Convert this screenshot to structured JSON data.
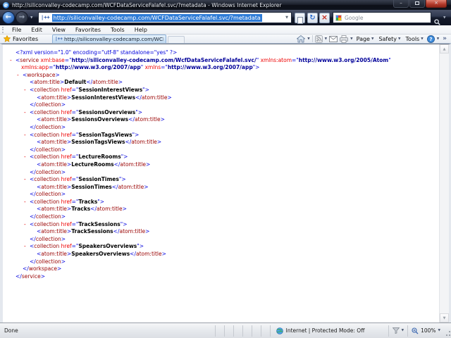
{
  "window": {
    "title": "http://siliconvalley-codecamp.com/WCFDataServiceFalafel.svc/?metadata - Windows Internet Explorer"
  },
  "icons": {
    "ie_logo": "e",
    "back": "←",
    "forward": "→",
    "dropdown": "▼",
    "refresh": "↻",
    "stop": "×",
    "minimize": "–",
    "close": "×",
    "scroll_up": "▲",
    "scroll_down": "▼",
    "overflow": "»",
    "help": "?"
  },
  "nav": {
    "address": "http://siliconvalley-codecamp.com/WCFDataServiceFalafel.svc/?metadata",
    "favicon_text": "|++",
    "search_placeholder": "Google"
  },
  "menu": {
    "items": [
      "File",
      "Edit",
      "View",
      "Favorites",
      "Tools",
      "Help"
    ]
  },
  "favorites": {
    "label": "Favorites",
    "tab": {
      "favicon_text": "|++",
      "title": "http://siliconvalley-codecamp.com/WCFDataSer..."
    },
    "commands": {
      "page": "Page",
      "safety": "Safety",
      "tools": "Tools"
    }
  },
  "status": {
    "text": "Done",
    "zone": "Internet | Protected Mode: Off",
    "zoom_level": "100%"
  },
  "colors": {
    "xml_markup": "#0000dd",
    "xml_tag": "#990000",
    "xml_attr": "#ee0000",
    "xml_url_value": "#000099",
    "xml_text": "#000000",
    "selection": "#2e7bd6",
    "close_button": "#b33a2b"
  },
  "xml": {
    "lines": [
      {
        "i": 0,
        "d": false,
        "segs": [
          [
            "m",
            "<?xml version=\"1.0\" encoding=\"utf-8\" standalone=\"yes\" ?>"
          ]
        ]
      },
      {
        "i": 0,
        "d": true,
        "segs": [
          [
            "m",
            "<"
          ],
          [
            "t",
            "service"
          ],
          [
            "a",
            " xml:base"
          ],
          [
            "m",
            "=\""
          ],
          [
            "u",
            "http://siliconvalley-codecamp.com/WcfDataServiceFalafel.svc/"
          ],
          [
            "m",
            "\" "
          ],
          [
            "a",
            "xmlns:atom"
          ],
          [
            "m",
            "=\""
          ],
          [
            "u",
            "http://www.w3.org/2005/Atom"
          ],
          [
            "m",
            "\""
          ]
        ]
      },
      {
        "i": 0,
        "d": false,
        "c": true,
        "segs": [
          [
            "a",
            "xmlns:app"
          ],
          [
            "m",
            "=\""
          ],
          [
            "u",
            "http://www.w3.org/2007/app"
          ],
          [
            "m",
            "\" "
          ],
          [
            "a",
            "xmlns"
          ],
          [
            "m",
            "=\""
          ],
          [
            "u",
            "http://www.w3.org/2007/app"
          ],
          [
            "m",
            "\">"
          ]
        ]
      },
      {
        "i": 1,
        "d": true,
        "segs": [
          [
            "m",
            "<"
          ],
          [
            "t",
            "workspace"
          ],
          [
            "m",
            ">"
          ]
        ]
      },
      {
        "i": 2,
        "d": false,
        "segs": [
          [
            "m",
            "<"
          ],
          [
            "t",
            "atom:title"
          ],
          [
            "m",
            ">"
          ],
          [
            "b",
            "Default"
          ],
          [
            "m",
            "</"
          ],
          [
            "t",
            "atom:title"
          ],
          [
            "m",
            ">"
          ]
        ]
      },
      {
        "i": 2,
        "d": true,
        "segs": [
          [
            "m",
            "<"
          ],
          [
            "t",
            "collection"
          ],
          [
            "a",
            " href"
          ],
          [
            "m",
            "=\""
          ],
          [
            "b",
            "SessionInterestViews"
          ],
          [
            "m",
            "\">"
          ]
        ]
      },
      {
        "i": 3,
        "d": false,
        "segs": [
          [
            "m",
            "<"
          ],
          [
            "t",
            "atom:title"
          ],
          [
            "m",
            ">"
          ],
          [
            "b",
            "SessionInterestViews"
          ],
          [
            "m",
            "</"
          ],
          [
            "t",
            "atom:title"
          ],
          [
            "m",
            ">"
          ]
        ]
      },
      {
        "i": 2,
        "d": false,
        "segs": [
          [
            "m",
            "</"
          ],
          [
            "t",
            "collection"
          ],
          [
            "m",
            ">"
          ]
        ]
      },
      {
        "i": 2,
        "d": true,
        "segs": [
          [
            "m",
            "<"
          ],
          [
            "t",
            "collection"
          ],
          [
            "a",
            " href"
          ],
          [
            "m",
            "=\""
          ],
          [
            "b",
            "SessionsOverviews"
          ],
          [
            "m",
            "\">"
          ]
        ]
      },
      {
        "i": 3,
        "d": false,
        "segs": [
          [
            "m",
            "<"
          ],
          [
            "t",
            "atom:title"
          ],
          [
            "m",
            ">"
          ],
          [
            "b",
            "SessionsOverviews"
          ],
          [
            "m",
            "</"
          ],
          [
            "t",
            "atom:title"
          ],
          [
            "m",
            ">"
          ]
        ]
      },
      {
        "i": 2,
        "d": false,
        "segs": [
          [
            "m",
            "</"
          ],
          [
            "t",
            "collection"
          ],
          [
            "m",
            ">"
          ]
        ]
      },
      {
        "i": 2,
        "d": true,
        "segs": [
          [
            "m",
            "<"
          ],
          [
            "t",
            "collection"
          ],
          [
            "a",
            " href"
          ],
          [
            "m",
            "=\""
          ],
          [
            "b",
            "SessionTagsViews"
          ],
          [
            "m",
            "\">"
          ]
        ]
      },
      {
        "i": 3,
        "d": false,
        "segs": [
          [
            "m",
            "<"
          ],
          [
            "t",
            "atom:title"
          ],
          [
            "m",
            ">"
          ],
          [
            "b",
            "SessionTagsViews"
          ],
          [
            "m",
            "</"
          ],
          [
            "t",
            "atom:title"
          ],
          [
            "m",
            ">"
          ]
        ]
      },
      {
        "i": 2,
        "d": false,
        "segs": [
          [
            "m",
            "</"
          ],
          [
            "t",
            "collection"
          ],
          [
            "m",
            ">"
          ]
        ]
      },
      {
        "i": 2,
        "d": true,
        "segs": [
          [
            "m",
            "<"
          ],
          [
            "t",
            "collection"
          ],
          [
            "a",
            " href"
          ],
          [
            "m",
            "=\""
          ],
          [
            "b",
            "LectureRooms"
          ],
          [
            "m",
            "\">"
          ]
        ]
      },
      {
        "i": 3,
        "d": false,
        "segs": [
          [
            "m",
            "<"
          ],
          [
            "t",
            "atom:title"
          ],
          [
            "m",
            ">"
          ],
          [
            "b",
            "LectureRooms"
          ],
          [
            "m",
            "</"
          ],
          [
            "t",
            "atom:title"
          ],
          [
            "m",
            ">"
          ]
        ]
      },
      {
        "i": 2,
        "d": false,
        "segs": [
          [
            "m",
            "</"
          ],
          [
            "t",
            "collection"
          ],
          [
            "m",
            ">"
          ]
        ]
      },
      {
        "i": 2,
        "d": true,
        "segs": [
          [
            "m",
            "<"
          ],
          [
            "t",
            "collection"
          ],
          [
            "a",
            " href"
          ],
          [
            "m",
            "=\""
          ],
          [
            "b",
            "SessionTimes"
          ],
          [
            "m",
            "\">"
          ]
        ]
      },
      {
        "i": 3,
        "d": false,
        "segs": [
          [
            "m",
            "<"
          ],
          [
            "t",
            "atom:title"
          ],
          [
            "m",
            ">"
          ],
          [
            "b",
            "SessionTimes"
          ],
          [
            "m",
            "</"
          ],
          [
            "t",
            "atom:title"
          ],
          [
            "m",
            ">"
          ]
        ]
      },
      {
        "i": 2,
        "d": false,
        "segs": [
          [
            "m",
            "</"
          ],
          [
            "t",
            "collection"
          ],
          [
            "m",
            ">"
          ]
        ]
      },
      {
        "i": 2,
        "d": true,
        "segs": [
          [
            "m",
            "<"
          ],
          [
            "t",
            "collection"
          ],
          [
            "a",
            " href"
          ],
          [
            "m",
            "=\""
          ],
          [
            "b",
            "Tracks"
          ],
          [
            "m",
            "\">"
          ]
        ]
      },
      {
        "i": 3,
        "d": false,
        "segs": [
          [
            "m",
            "<"
          ],
          [
            "t",
            "atom:title"
          ],
          [
            "m",
            ">"
          ],
          [
            "b",
            "Tracks"
          ],
          [
            "m",
            "</"
          ],
          [
            "t",
            "atom:title"
          ],
          [
            "m",
            ">"
          ]
        ]
      },
      {
        "i": 2,
        "d": false,
        "segs": [
          [
            "m",
            "</"
          ],
          [
            "t",
            "collection"
          ],
          [
            "m",
            ">"
          ]
        ]
      },
      {
        "i": 2,
        "d": true,
        "segs": [
          [
            "m",
            "<"
          ],
          [
            "t",
            "collection"
          ],
          [
            "a",
            " href"
          ],
          [
            "m",
            "=\""
          ],
          [
            "b",
            "TrackSessions"
          ],
          [
            "m",
            "\">"
          ]
        ]
      },
      {
        "i": 3,
        "d": false,
        "segs": [
          [
            "m",
            "<"
          ],
          [
            "t",
            "atom:title"
          ],
          [
            "m",
            ">"
          ],
          [
            "b",
            "TrackSessions"
          ],
          [
            "m",
            "</"
          ],
          [
            "t",
            "atom:title"
          ],
          [
            "m",
            ">"
          ]
        ]
      },
      {
        "i": 2,
        "d": false,
        "segs": [
          [
            "m",
            "</"
          ],
          [
            "t",
            "collection"
          ],
          [
            "m",
            ">"
          ]
        ]
      },
      {
        "i": 2,
        "d": true,
        "segs": [
          [
            "m",
            "<"
          ],
          [
            "t",
            "collection"
          ],
          [
            "a",
            " href"
          ],
          [
            "m",
            "=\""
          ],
          [
            "b",
            "SpeakersOverviews"
          ],
          [
            "m",
            "\">"
          ]
        ]
      },
      {
        "i": 3,
        "d": false,
        "segs": [
          [
            "m",
            "<"
          ],
          [
            "t",
            "atom:title"
          ],
          [
            "m",
            ">"
          ],
          [
            "b",
            "SpeakersOverviews"
          ],
          [
            "m",
            "</"
          ],
          [
            "t",
            "atom:title"
          ],
          [
            "m",
            ">"
          ]
        ]
      },
      {
        "i": 2,
        "d": false,
        "segs": [
          [
            "m",
            "</"
          ],
          [
            "t",
            "collection"
          ],
          [
            "m",
            ">"
          ]
        ]
      },
      {
        "i": 1,
        "d": false,
        "segs": [
          [
            "m",
            "</"
          ],
          [
            "t",
            "workspace"
          ],
          [
            "m",
            ">"
          ]
        ]
      },
      {
        "i": 0,
        "d": false,
        "segs": [
          [
            "m",
            "</"
          ],
          [
            "t",
            "service"
          ],
          [
            "m",
            ">"
          ]
        ]
      }
    ]
  }
}
